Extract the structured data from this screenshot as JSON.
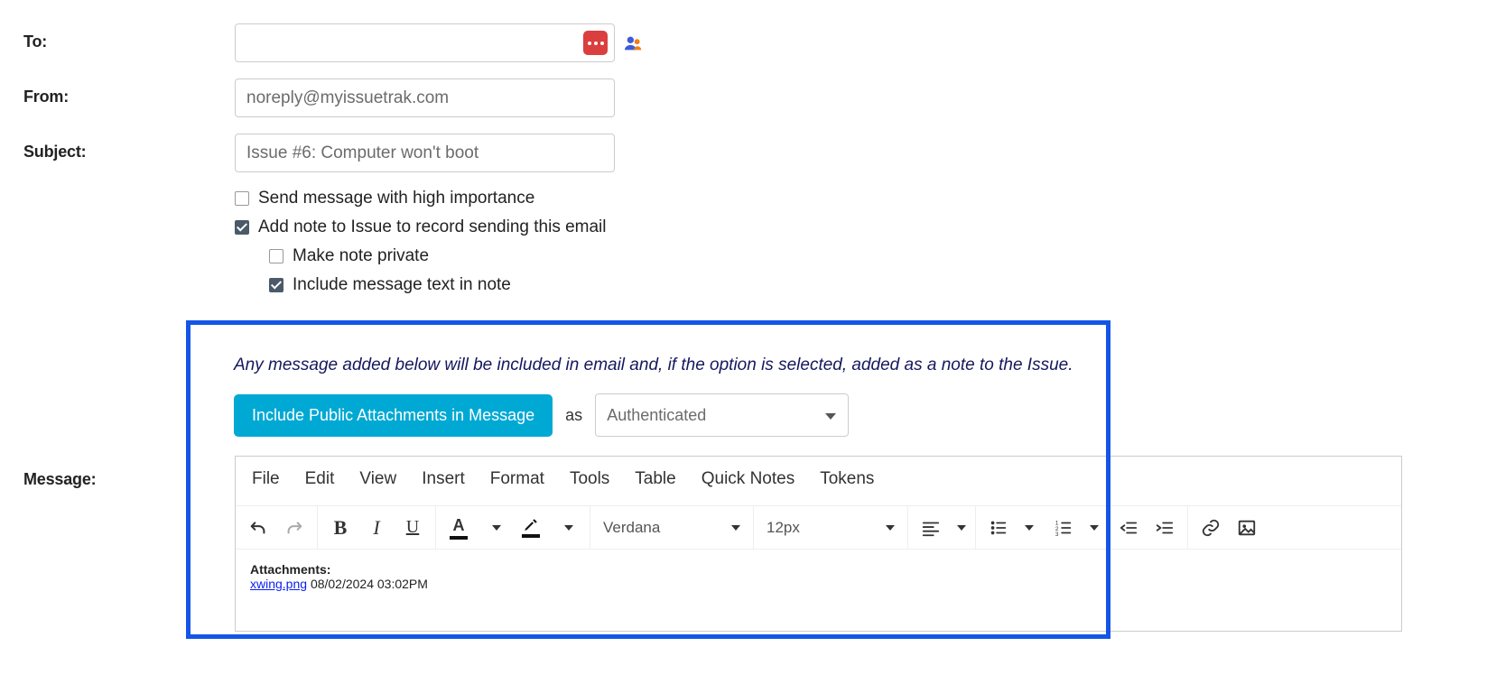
{
  "labels": {
    "to": "To:",
    "from": "From:",
    "subject": "Subject:",
    "message": "Message:"
  },
  "fields": {
    "to_value": "",
    "from_value": "noreply@myissuetrak.com",
    "subject_value": "Issue #6: Computer won't boot"
  },
  "checkboxes": {
    "high_importance": {
      "label": "Send message with high importance",
      "checked": false
    },
    "add_note": {
      "label": "Add note to Issue to record sending this email",
      "checked": true
    },
    "make_private": {
      "label": "Make note private",
      "checked": false
    },
    "include_text": {
      "label": "Include message text in note",
      "checked": true
    }
  },
  "hint": "Any message added below will be included in email and, if the option is selected, added as a note to the Issue.",
  "attachments_button": "Include Public Attachments in Message",
  "as_label": "as",
  "auth_value": "Authenticated",
  "editor": {
    "menus": [
      "File",
      "Edit",
      "View",
      "Insert",
      "Format",
      "Tools",
      "Table",
      "Quick Notes",
      "Tokens"
    ],
    "font": "Verdana",
    "font_size": "12px",
    "content_label": "Attachments:",
    "attachment_name": "xwing.png",
    "attachment_timestamp": "08/02/2024 03:02PM"
  }
}
